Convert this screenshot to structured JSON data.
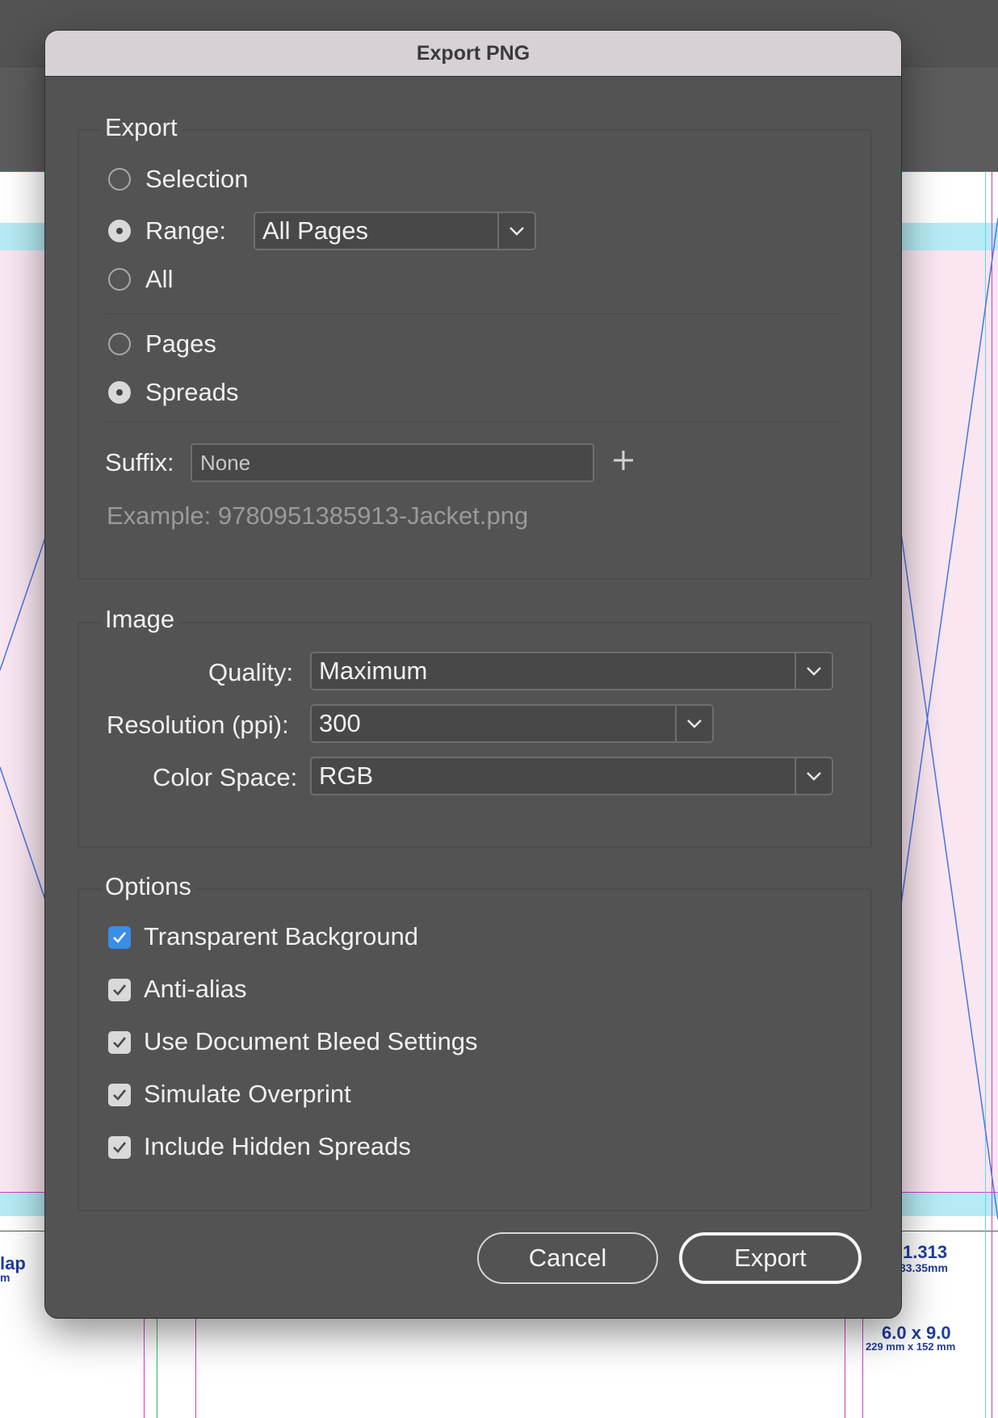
{
  "dialog": {
    "title": "Export PNG"
  },
  "export_group": {
    "title": "Export",
    "selection_label": "Selection",
    "range_label": "Range:",
    "range_value": "All Pages",
    "all_label": "All",
    "pages_label": "Pages",
    "spreads_label": "Spreads",
    "selected_scope": "Range",
    "selected_layout": "Spreads",
    "suffix_label": "Suffix:",
    "suffix_placeholder": "None",
    "example_text": "Example: 9780951385913-Jacket.png"
  },
  "image_group": {
    "title": "Image",
    "quality_label": "Quality:",
    "quality_value": "Maximum",
    "resolution_label": "Resolution (ppi):",
    "resolution_value": "300",
    "color_space_label": "Color Space:",
    "color_space_value": "RGB"
  },
  "options_group": {
    "title": "Options",
    "items": [
      {
        "label": "Transparent Background",
        "checked": true
      },
      {
        "label": "Anti-alias",
        "checked": true
      },
      {
        "label": "Use Document Bleed Settings",
        "checked": true
      },
      {
        "label": "Simulate Overprint",
        "checked": true
      },
      {
        "label": "Include Hidden Spreads",
        "checked": true
      }
    ]
  },
  "buttons": {
    "cancel": "Cancel",
    "export": "Export"
  },
  "background_doc": {
    "left_label_line1": "lap",
    "left_label_line2": "m",
    "spine_inches": "1.313",
    "spine_mm": "33.35mm",
    "size_inches": "6.0 x 9.0",
    "size_mm": "229 mm x 152 mm"
  },
  "colors": {
    "accent": "#3a8ee6",
    "dialog_bg": "#535353",
    "titlebar_bg": "#d7d1d6",
    "guide_magenta": "#c93fc9",
    "guide_cyan": "#5fd3ea"
  }
}
